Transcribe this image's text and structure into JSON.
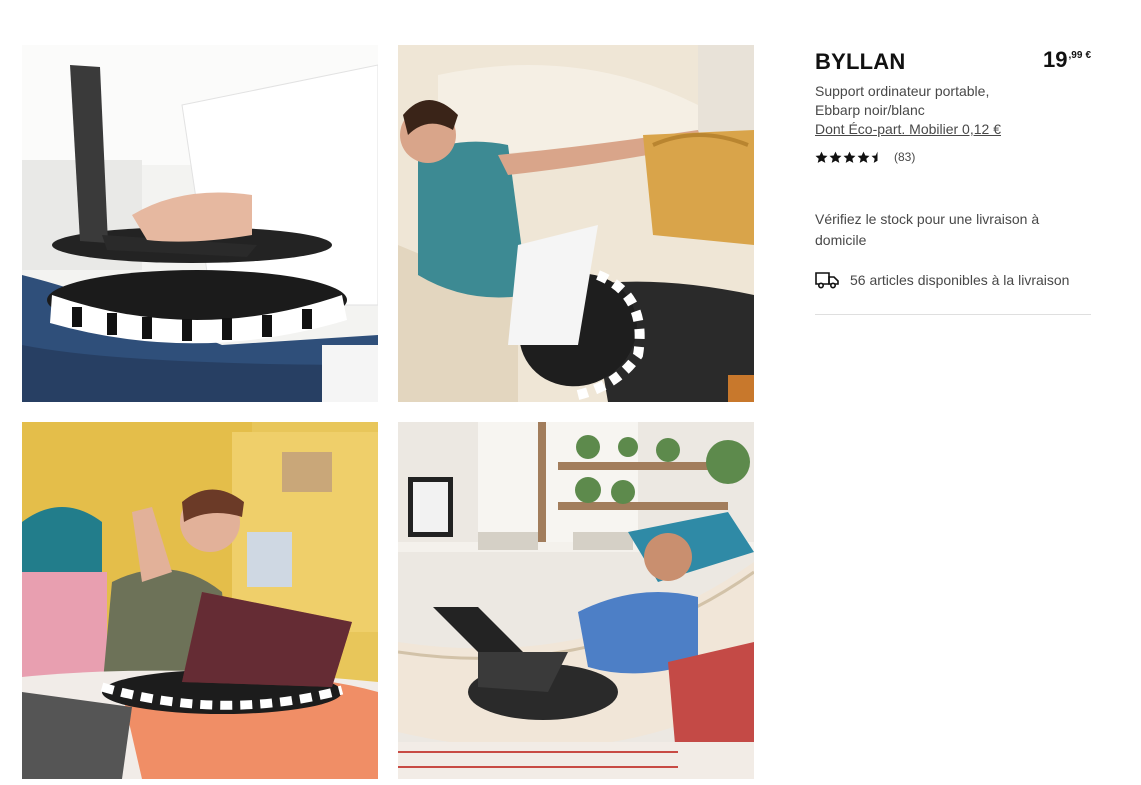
{
  "product": {
    "name": "BYLLAN",
    "price": {
      "integer": "19",
      "decimals": ",99",
      "currency": "€"
    },
    "description_line1": "Support ordinateur portable,",
    "description_line2": "Ebbarp noir/blanc",
    "ecopart": "Dont Éco-part. Mobilier 0,12 €",
    "rating": {
      "value": 4.5,
      "max": 5,
      "count": "(83)"
    }
  },
  "availability": {
    "check_stock_text": "Vérifiez le stock pour une livraison à domicile",
    "delivery_text": "56 articles disponibles à la livraison",
    "delivery_icon": "truck-icon"
  },
  "gallery": {
    "images": [
      {
        "subject": "person typing on laptop on lap desk"
      },
      {
        "subject": "boy on sofa with lap desk and bag"
      },
      {
        "subject": "girl on bed with laptop on lap desk"
      },
      {
        "subject": "man in hammock with laptop on lap desk"
      }
    ]
  },
  "colors": {
    "text": "#111111",
    "secondary_text": "#484848",
    "divider": "#dfdfdf"
  }
}
